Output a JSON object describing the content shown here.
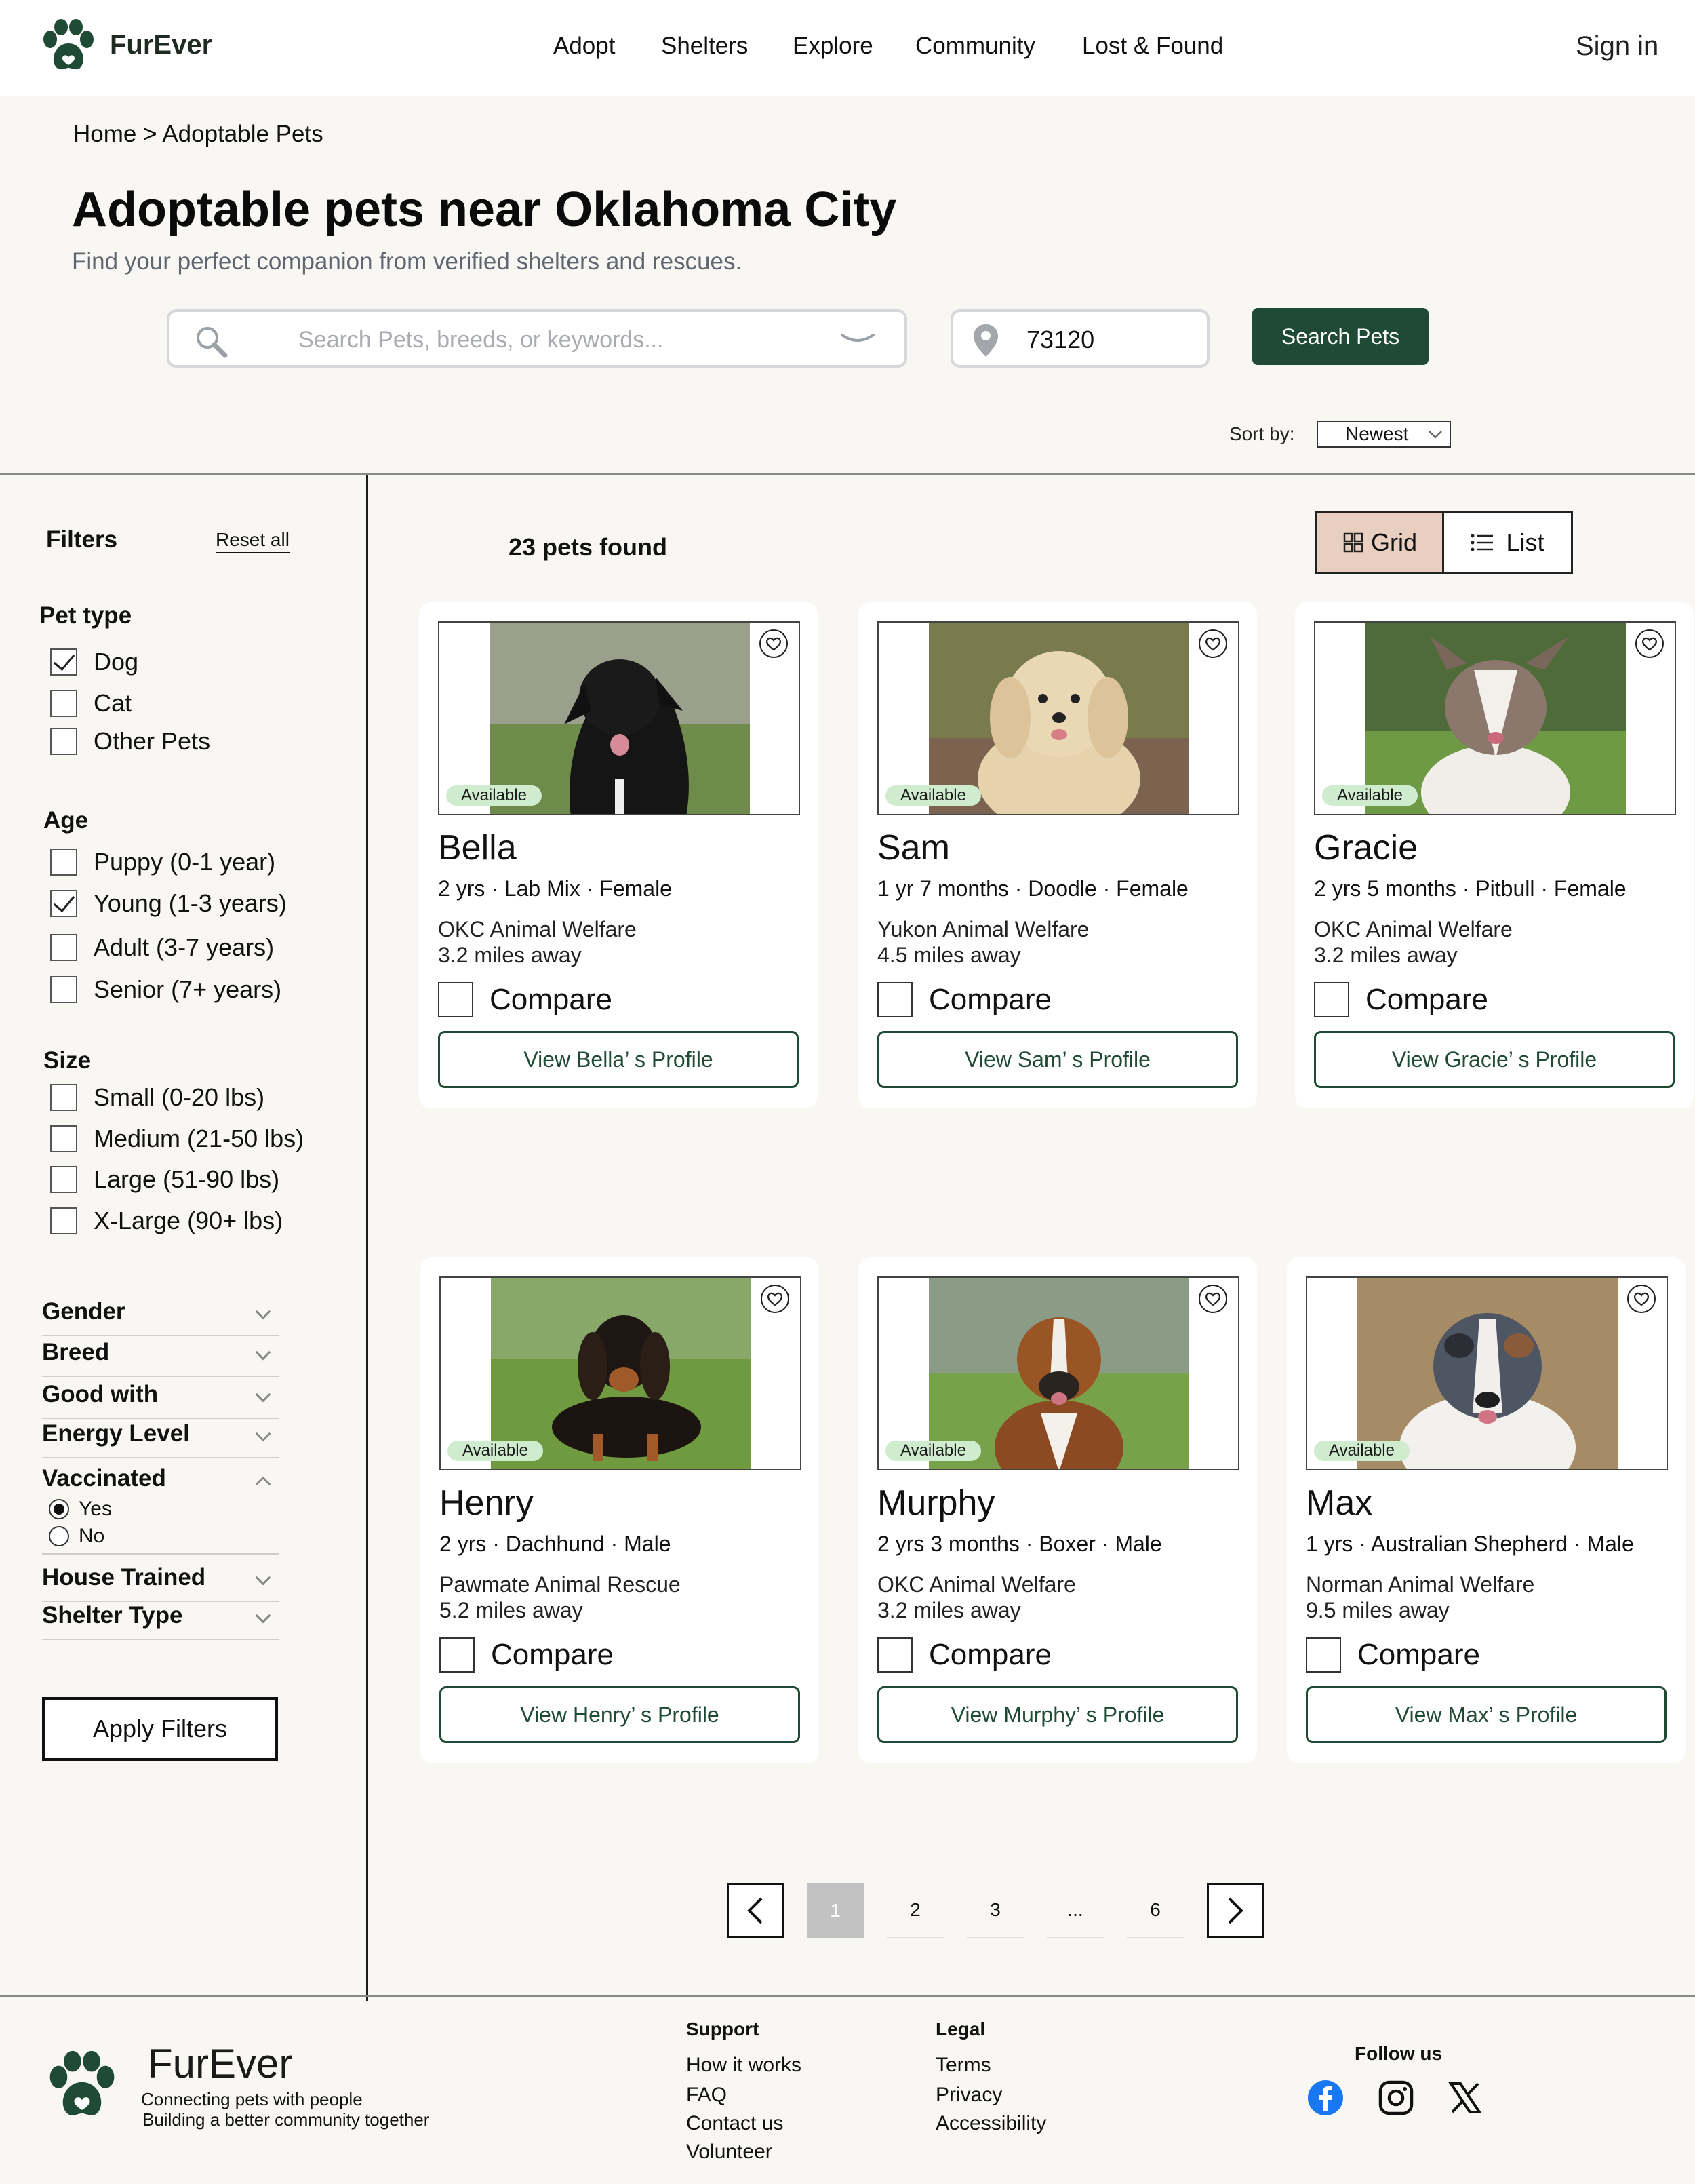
{
  "header": {
    "brand": "FurEver",
    "nav": [
      "Adopt",
      "Shelters",
      "Explore",
      "Community",
      "Lost & Found"
    ],
    "sign_in": "Sign in"
  },
  "breadcrumb": "Home > Adoptable Pets",
  "title": "Adoptable pets near Oklahoma City",
  "subtitle": "Find your perfect companion from verified shelters and rescues.",
  "search": {
    "placeholder": "Search Pets, breeds, or keywords...",
    "zip": "73120",
    "button": "Search Pets"
  },
  "sort": {
    "label": "Sort by:",
    "value": "Newest"
  },
  "filters": {
    "title": "Filters",
    "reset": "Reset all",
    "pet_type": {
      "title": "Pet type",
      "options": [
        {
          "label": "Dog",
          "checked": true
        },
        {
          "label": "Cat",
          "checked": false
        },
        {
          "label": "Other Pets",
          "checked": false
        }
      ]
    },
    "age": {
      "title": "Age",
      "options": [
        {
          "label": "Puppy (0-1 year)",
          "checked": false
        },
        {
          "label": "Young (1-3 years)",
          "checked": true
        },
        {
          "label": "Adult (3-7 years)",
          "checked": false
        },
        {
          "label": "Senior (7+ years)",
          "checked": false
        }
      ]
    },
    "size": {
      "title": "Size",
      "options": [
        {
          "label": "Small (0-20 lbs)",
          "checked": false
        },
        {
          "label": "Medium (21-50 lbs)",
          "checked": false
        },
        {
          "label": "Large (51-90 lbs)",
          "checked": false
        },
        {
          "label": "X-Large (90+ lbs)",
          "checked": false
        }
      ]
    },
    "accordions": [
      "Gender",
      "Breed",
      "Good with",
      "Energy Level"
    ],
    "vaccinated": {
      "title": "Vaccinated",
      "yes": "Yes",
      "no": "No",
      "selected": "Yes"
    },
    "accordions_after": [
      "House Trained",
      "Shelter Type"
    ],
    "apply": "Apply Filters"
  },
  "results": {
    "count": "23 pets found",
    "grid_label": "Grid",
    "list_label": "List"
  },
  "compare_label": "Compare",
  "available_label": "Available",
  "pets": [
    {
      "name": "Bella",
      "info": "2 yrs · Lab Mix · Female",
      "shelter": "OKC Animal Welfare",
      "distance": "3.2 miles away",
      "button": "View Bella’ s Profile"
    },
    {
      "name": "Sam",
      "info": "1 yr 7 months · Doodle · Female",
      "shelter": "Yukon Animal Welfare",
      "distance": "4.5 miles away",
      "button": "View Sam’ s Profile"
    },
    {
      "name": "Gracie",
      "info": "2 yrs 5 months · Pitbull · Female",
      "shelter": "OKC Animal Welfare",
      "distance": "3.2 miles away",
      "button": "View Gracie’ s Profile"
    },
    {
      "name": "Henry",
      "info": "2 yrs · Dachhund · Male",
      "shelter": "Pawmate Animal Rescue",
      "distance": "5.2 miles away",
      "button": "View Henry’ s Profile"
    },
    {
      "name": "Murphy",
      "info": "2 yrs 3 months · Boxer · Male",
      "shelter": "OKC Animal Welfare",
      "distance": "3.2 miles away",
      "button": "View Murphy’ s Profile"
    },
    {
      "name": "Max",
      "info": "1 yrs · Australian Shepherd · Male",
      "shelter": "Norman Animal Welfare",
      "distance": "9.5 miles away",
      "button": "View Max’ s Profile"
    }
  ],
  "pagination": {
    "pages": [
      "1",
      "2",
      "3",
      "...",
      "6"
    ],
    "current": "1"
  },
  "footer": {
    "brand": "FurEver",
    "tagline1": "Connecting pets with people",
    "tagline2": "Building a better community together",
    "support_title": "Support",
    "support_links": [
      "How it works",
      "FAQ",
      "Contact us",
      "Volunteer"
    ],
    "legal_title": "Legal",
    "legal_links": [
      "Terms",
      "Privacy",
      "Accessibility"
    ],
    "follow_title": "Follow us"
  },
  "colors": {
    "brand_green": "#1f4a35",
    "available_badge": "#cfeccf",
    "grid_toggle": "#e8cfc0",
    "background": "#f9f7f3"
  },
  "icons": [
    "paw-logo-icon",
    "search-icon",
    "chevron-down-icon",
    "location-pin-icon",
    "heart-icon",
    "grid-icon",
    "list-icon",
    "chevron-left-icon",
    "chevron-right-icon",
    "facebook-icon",
    "instagram-icon",
    "x-icon"
  ]
}
